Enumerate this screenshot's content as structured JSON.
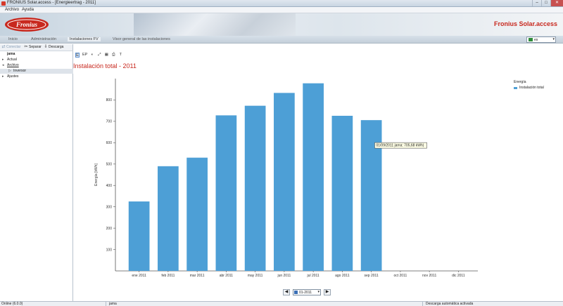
{
  "window": {
    "title": "FRONIUS Solar.access - [Energieertrag - 2011]",
    "min": "–",
    "max": "□",
    "close": "✕"
  },
  "menu": {
    "items": [
      "Archivo",
      "Ayuda"
    ]
  },
  "brand": {
    "logo_text": "Fronius",
    "title": "Fronius Solar.access",
    "accent": "#c8281e"
  },
  "nav": {
    "items": [
      "Inicio",
      "Administración",
      "Instalaciones FV",
      "Visor general de las instalaciones"
    ],
    "active_index": 2
  },
  "language": {
    "value": "es"
  },
  "left_toolbar": {
    "connect": "Conectar",
    "disconnect": "Separar",
    "download": "Descarga"
  },
  "tree": {
    "root": "jama",
    "items": [
      {
        "label": "Actual",
        "expander": "▸"
      },
      {
        "label": "Archivo",
        "expander": "◂"
      },
      {
        "label": "Inversor",
        "expander": "▷"
      },
      {
        "label": "Ajustes",
        "expander": "▸"
      }
    ]
  },
  "chart_toolbar": {
    "buttons": [
      "E",
      "EP",
      "◐",
      "⤢",
      "▦",
      "⎙",
      "T"
    ]
  },
  "chart_tooltip": "01/09/2011 jama: 705,68 kWh)",
  "chart_data": {
    "type": "bar",
    "title": "Instalación total - 2011",
    "ylabel": "Energía [kWh]",
    "xlabel": "",
    "ylim": [
      0,
      900
    ],
    "yticks": [
      100,
      200,
      300,
      400,
      500,
      600,
      700,
      800
    ],
    "categories": [
      "ene 2011",
      "feb 2011",
      "mar 2011",
      "abr 2011",
      "may 2011",
      "jun 2011",
      "jul 2011",
      "ago 2011",
      "sep 2011",
      "oct 2011",
      "nov 2011",
      "dic 2011"
    ],
    "series": [
      {
        "name": "Instalación total",
        "color": "#4d9fd6",
        "values": [
          325,
          490,
          530,
          728,
          773,
          833,
          878,
          726,
          705.68,
          null,
          null,
          null
        ]
      }
    ],
    "legend": {
      "title": "Energía",
      "placement": "top-right"
    },
    "grid": false
  },
  "pager": {
    "prev": "◀",
    "next": "▶",
    "date": "01-2011"
  },
  "status": {
    "left": "Online (6.0.0)",
    "site": "jama",
    "right": "Descarga automática activada"
  }
}
